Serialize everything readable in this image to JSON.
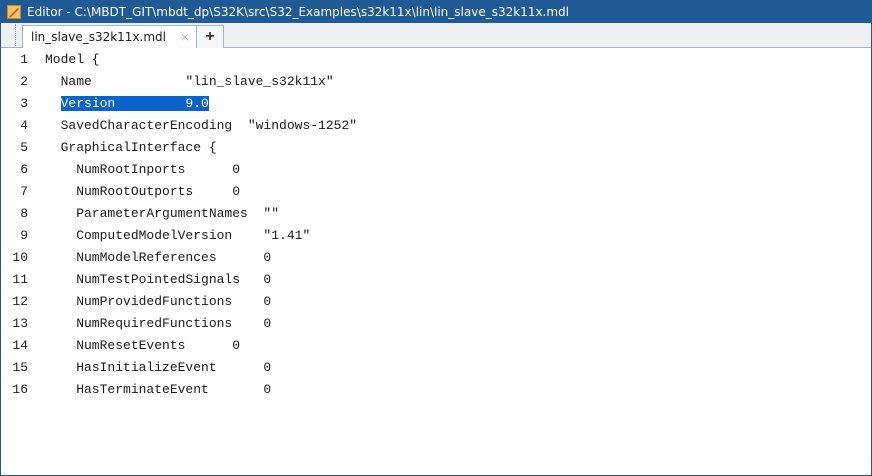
{
  "window": {
    "title": "Editor - C:\\MBDT_GIT\\mbdt_dp\\S32K\\src\\S32_Examples\\s32k11x\\lin\\lin_slave_s32k11x.mdl"
  },
  "tabs": [
    {
      "label": "lin_slave_s32k11x.mdl",
      "close": "×"
    }
  ],
  "add_tab_label": "+",
  "editor": {
    "lines": [
      {
        "num": "1",
        "text": "Model {"
      },
      {
        "num": "2",
        "text": "  Name            \"lin_slave_s32k11x\""
      },
      {
        "num": "3",
        "text": "  Version         9.0"
      },
      {
        "num": "4",
        "text": "  SavedCharacterEncoding  \"windows-1252\""
      },
      {
        "num": "5",
        "text": "  GraphicalInterface {"
      },
      {
        "num": "6",
        "text": "    NumRootInports      0"
      },
      {
        "num": "7",
        "text": "    NumRootOutports     0"
      },
      {
        "num": "8",
        "text": "    ParameterArgumentNames  \"\""
      },
      {
        "num": "9",
        "text": "    ComputedModelVersion    \"1.41\""
      },
      {
        "num": "10",
        "text": "    NumModelReferences      0"
      },
      {
        "num": "11",
        "text": "    NumTestPointedSignals   0"
      },
      {
        "num": "12",
        "text": "    NumProvidedFunctions    0"
      },
      {
        "num": "13",
        "text": "    NumRequiredFunctions    0"
      },
      {
        "num": "14",
        "text": "    NumResetEvents      0"
      },
      {
        "num": "15",
        "text": "    HasInitializeEvent      0"
      },
      {
        "num": "16",
        "text": "    HasTerminateEvent       0"
      }
    ],
    "selected": {
      "line": "3",
      "indent": "  ",
      "text": "Version         9.0"
    }
  },
  "colors": {
    "titlebar": "#1f5a96",
    "selection": "#0a64c8"
  }
}
